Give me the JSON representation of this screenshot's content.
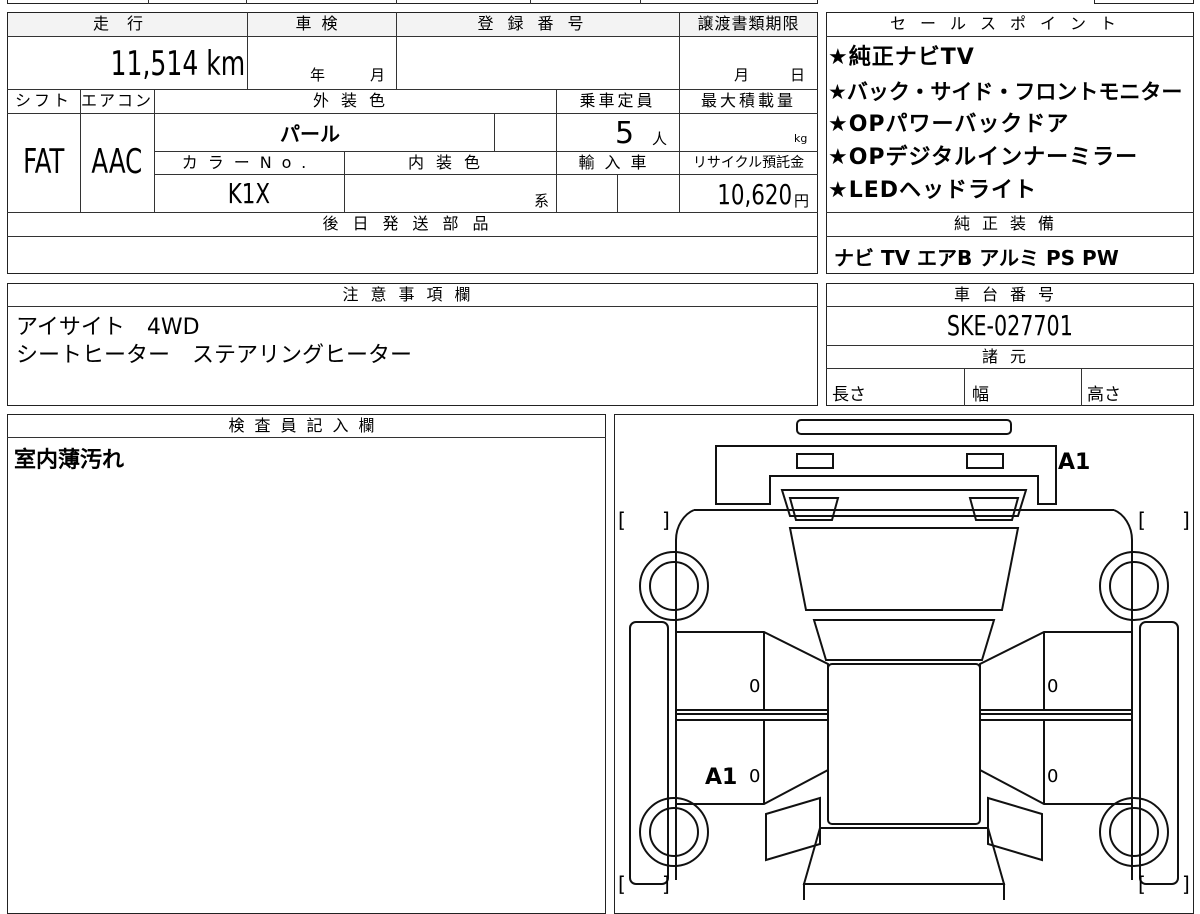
{
  "spec_table": {
    "mileage_label": "走行",
    "mileage_value": "11,514 km",
    "inspection_label": "車検",
    "inspection_year_unit": "年",
    "inspection_month_unit": "月",
    "registration_label": "登録番号",
    "transfer_deadline_label": "譲渡書類期限",
    "transfer_month_unit": "月",
    "transfer_day_unit": "日",
    "shift_label": "シフト",
    "shift_value": "FAT",
    "aircon_label": "エアコン",
    "aircon_value": "AAC",
    "exterior_color_label": "外装色",
    "exterior_color_value": "パール",
    "capacity_label": "乗車定員",
    "capacity_value": "5",
    "capacity_unit": "人",
    "max_load_label": "最大積載量",
    "max_load_unit": "kg",
    "color_no_label": "カラーNo.",
    "color_no_value": "K1X",
    "interior_color_label": "内装色",
    "interior_color_unit": "系",
    "import_label": "輸入車",
    "recycle_label": "リサイクル預託金",
    "recycle_value": "10,620",
    "recycle_unit": "円",
    "later_parts_label": "後日発送部品"
  },
  "sales_points": {
    "title": "セールスポイント",
    "items": [
      "★純正ナビTV",
      "★バック・サイド・フロントモニター",
      "★OPパワーバックドア",
      "★OPデジタルインナーミラー",
      "★LEDヘッドライト"
    ]
  },
  "genuine_equipment": {
    "title": "純正装備",
    "value": "ナビ TV エアB アルミ PS PW"
  },
  "notes": {
    "title": "注意事項欄",
    "lines": [
      "アイサイト　4WD",
      "シートヒーター　ステアリングヒーター"
    ]
  },
  "chassis": {
    "title": "車台番号",
    "value": "SKE-027701"
  },
  "specs": {
    "title": "諸元",
    "length_label": "長さ",
    "width_label": "幅",
    "height_label": "高さ"
  },
  "inspector": {
    "title": "検査員記入欄",
    "comment": "室内薄汚れ"
  },
  "diagram": {
    "rear_mark": "A1",
    "left_mark": "A1",
    "bracket_open": "[",
    "bracket_close": "]",
    "panel_zero": "0"
  }
}
